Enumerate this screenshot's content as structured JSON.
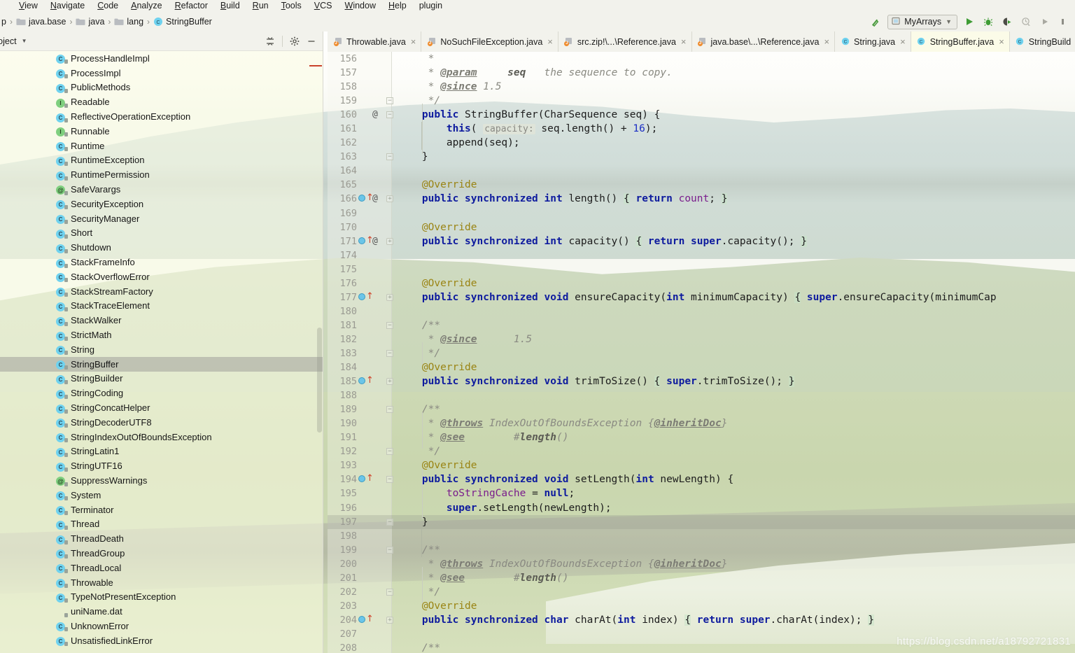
{
  "menubar": {
    "items": [
      "View",
      "Navigate",
      "Code",
      "Analyze",
      "Refactor",
      "Build",
      "Run",
      "Tools",
      "VCS",
      "Window",
      "Help",
      "plugin"
    ]
  },
  "navbar": {
    "crumbs": [
      {
        "label": "java.base",
        "icon": "folder-icon"
      },
      {
        "label": "java",
        "icon": "folder-icon"
      },
      {
        "label": "lang",
        "icon": "folder-icon"
      },
      {
        "label": "StringBuffer",
        "icon": "class-icon"
      }
    ],
    "build_icon": "hammer-build-icon",
    "run_config": {
      "label": "MyArrays",
      "icon": "run-config-icon",
      "chevron": "chevron-down-icon"
    },
    "actions": [
      "run-icon",
      "debug-icon",
      "run-with-coverage-icon",
      "profiler-icon",
      "rerun-icon",
      "stop-icon"
    ]
  },
  "sidebar": {
    "title": "roject",
    "actions": [
      "collapse-all-icon",
      "settings-gear-icon",
      "hide-panel-icon"
    ],
    "tree": [
      {
        "label": "ProcessHandleImpl",
        "kind": "class"
      },
      {
        "label": "ProcessImpl",
        "kind": "class"
      },
      {
        "label": "PublicMethods",
        "kind": "class"
      },
      {
        "label": "Readable",
        "kind": "interface"
      },
      {
        "label": "ReflectiveOperationException",
        "kind": "class"
      },
      {
        "label": "Runnable",
        "kind": "interface"
      },
      {
        "label": "Runtime",
        "kind": "class"
      },
      {
        "label": "RuntimeException",
        "kind": "class"
      },
      {
        "label": "RuntimePermission",
        "kind": "class"
      },
      {
        "label": "SafeVarargs",
        "kind": "annotation"
      },
      {
        "label": "SecurityException",
        "kind": "class"
      },
      {
        "label": "SecurityManager",
        "kind": "class"
      },
      {
        "label": "Short",
        "kind": "class"
      },
      {
        "label": "Shutdown",
        "kind": "class"
      },
      {
        "label": "StackFrameInfo",
        "kind": "class"
      },
      {
        "label": "StackOverflowError",
        "kind": "class"
      },
      {
        "label": "StackStreamFactory",
        "kind": "class"
      },
      {
        "label": "StackTraceElement",
        "kind": "class"
      },
      {
        "label": "StackWalker",
        "kind": "class"
      },
      {
        "label": "StrictMath",
        "kind": "class"
      },
      {
        "label": "String",
        "kind": "class"
      },
      {
        "label": "StringBuffer",
        "kind": "class",
        "selected": true
      },
      {
        "label": "StringBuilder",
        "kind": "class"
      },
      {
        "label": "StringCoding",
        "kind": "class"
      },
      {
        "label": "StringConcatHelper",
        "kind": "class"
      },
      {
        "label": "StringDecoderUTF8",
        "kind": "class"
      },
      {
        "label": "StringIndexOutOfBoundsException",
        "kind": "class"
      },
      {
        "label": "StringLatin1",
        "kind": "class"
      },
      {
        "label": "StringUTF16",
        "kind": "class"
      },
      {
        "label": "SuppressWarnings",
        "kind": "annotation"
      },
      {
        "label": "System",
        "kind": "class"
      },
      {
        "label": "Terminator",
        "kind": "class"
      },
      {
        "label": "Thread",
        "kind": "class"
      },
      {
        "label": "ThreadDeath",
        "kind": "class"
      },
      {
        "label": "ThreadGroup",
        "kind": "class"
      },
      {
        "label": "ThreadLocal",
        "kind": "class"
      },
      {
        "label": "Throwable",
        "kind": "class"
      },
      {
        "label": "TypeNotPresentException",
        "kind": "class"
      },
      {
        "label": "uniName.dat",
        "kind": "file"
      },
      {
        "label": "UnknownError",
        "kind": "class"
      },
      {
        "label": "UnsatisfiedLinkError",
        "kind": "class"
      }
    ]
  },
  "tabs": [
    {
      "label": "Throwable.java",
      "icon": "java-file-icon",
      "active": false
    },
    {
      "label": "NoSuchFileException.java",
      "icon": "java-file-icon",
      "active": false
    },
    {
      "label": "src.zip!\\...\\Reference.java",
      "icon": "java-file-icon",
      "active": false
    },
    {
      "label": "java.base\\...\\Reference.java",
      "icon": "java-file-icon",
      "active": false
    },
    {
      "label": "String.java",
      "icon": "class-file-icon",
      "active": false
    },
    {
      "label": "StringBuffer.java",
      "icon": "class-file-icon",
      "active": true
    },
    {
      "label": "StringBuild",
      "icon": "class-file-icon",
      "active": false
    }
  ],
  "tab_close_glyph": "×",
  "editor": {
    "file": "StringBuffer.java",
    "lines": [
      {
        "n": "156",
        "html": "<span class='cmt'>     *</span>"
      },
      {
        "n": "157",
        "html": "<span class='cmt'>     * </span><span class='tag'>@param</span><span class='cmt'>     </span><span class='cmtb'>seq</span><span class='cmt'>   the sequence to copy.</span>"
      },
      {
        "n": "158",
        "html": "<span class='cmt'>     * </span><span class='tag'>@since</span><span class='cmt'> 1.5</span>"
      },
      {
        "n": "159",
        "html": "<span class='cmt'>     */</span>",
        "fold": "minus",
        "at": false
      },
      {
        "n": "160",
        "html": "<span class='kw'>    public </span><span class='id'>StringBuffer(CharSequence seq) </span><span class='brc2'>{</span>",
        "at": true,
        "fold": "minus-stem"
      },
      {
        "n": "161",
        "html": "<span class='id'>        </span><span class='kw'>this</span><span class='id'>( </span><span class='hint'>capacity:</span><span class='id'> seq.length() + </span><span class='num'>16</span><span class='id'>);</span>"
      },
      {
        "n": "162",
        "html": "<span class='id'>        append(seq);</span>"
      },
      {
        "n": "163",
        "html": "<span class='id'>    }</span>",
        "fold": "minus-end"
      },
      {
        "n": "164",
        "html": ""
      },
      {
        "n": "165",
        "html": "<span class='anno'>    @Override</span>"
      },
      {
        "n": "166",
        "html": "<span class='kw'>    public synchronized int </span><span class='id'>length() </span><span class='brc'>{</span><span class='kw'> return </span><span class='fld'>count</span><span class='id'>; </span><span class='brc'>}</span>",
        "override": true,
        "at": true,
        "fold": "plus"
      },
      {
        "n": "169",
        "html": ""
      },
      {
        "n": "170",
        "html": "<span class='anno'>    @Override</span>"
      },
      {
        "n": "171",
        "html": "<span class='kw'>    public synchronized int </span><span class='id'>capacity() </span><span class='brc'>{</span><span class='kw'> return </span><span class='kw'>super</span><span class='id'>.capacity(); </span><span class='brc'>}</span>",
        "override": true,
        "at": true,
        "fold": "plus"
      },
      {
        "n": "174",
        "html": ""
      },
      {
        "n": "175",
        "html": ""
      },
      {
        "n": "176",
        "html": "<span class='anno'>    @Override</span>"
      },
      {
        "n": "177",
        "html": "<span class='kw'>    public synchronized void </span><span class='id'>ensureCapacity(</span><span class='kw'>int </span><span class='id'>minimumCapacity) </span><span class='brc'>{</span><span class='kw'> super</span><span class='id'>.ensureCapacity(minimumCap</span>",
        "override": true,
        "fold": "plus"
      },
      {
        "n": "180",
        "html": ""
      },
      {
        "n": "181",
        "html": "<span class='cmt'>    /**</span>",
        "fold": "minus"
      },
      {
        "n": "182",
        "html": "<span class='cmt'>     * </span><span class='tag'>@since</span><span class='cmt'>      1.5</span>"
      },
      {
        "n": "183",
        "html": "<span class='cmt'>     */</span>",
        "fold": "minus-end"
      },
      {
        "n": "184",
        "html": "<span class='anno'>    @Override</span>"
      },
      {
        "n": "185",
        "html": "<span class='kw'>    public synchronized void </span><span class='id'>trimToSize() </span><span class='brc'>{</span><span class='kw'> super</span><span class='id'>.trimToSize(); </span><span class='brc'>}</span>",
        "override": true,
        "fold": "plus"
      },
      {
        "n": "188",
        "html": ""
      },
      {
        "n": "189",
        "html": "<span class='cmt'>    /**</span>",
        "fold": "minus"
      },
      {
        "n": "190",
        "html": "<span class='cmt'>     * </span><span class='tag'>@throws</span><span class='cmt'> IndexOutOfBoundsException {</span><span class='tag'>@inheritDoc</span><span class='cmt'>}</span>"
      },
      {
        "n": "191",
        "html": "<span class='cmt'>     * </span><span class='tag'>@see</span><span class='cmt'>        #</span><span class='cmtb'>length</span><span class='cmt'>()</span>"
      },
      {
        "n": "192",
        "html": "<span class='cmt'>     */</span>",
        "fold": "minus-end"
      },
      {
        "n": "193",
        "html": "<span class='anno'>    @Override</span>"
      },
      {
        "n": "194",
        "html": "<span class='kw'>    public synchronized void </span><span class='id'>setLength(</span><span class='kw'>int </span><span class='id'>newLength) </span><span class='brc2'>{</span>",
        "override": true,
        "fold": "minus-stem"
      },
      {
        "n": "195",
        "html": "<span class='id'>        </span><span class='fld'>toStringCache</span><span class='id'> = </span><span class='kw'>null</span><span class='id'>;</span>"
      },
      {
        "n": "196",
        "html": "<span class='id'>        </span><span class='kw'>super</span><span class='id'>.setLength(newLength);</span>"
      },
      {
        "n": "197",
        "html": "<span class='id'>    }</span>",
        "caret": true,
        "fold": "minus-end"
      },
      {
        "n": "198",
        "html": ""
      },
      {
        "n": "199",
        "html": "<span class='cmt'>    /**</span>",
        "fold": "minus"
      },
      {
        "n": "200",
        "html": "<span class='cmt'>     * </span><span class='tag'>@throws</span><span class='cmt'> IndexOutOfBoundsException {</span><span class='tag'>@inheritDoc</span><span class='cmt'>}</span>"
      },
      {
        "n": "201",
        "html": "<span class='cmt'>     * </span><span class='tag'>@see</span><span class='cmt'>        #</span><span class='cmtb'>length</span><span class='cmt'>()</span>"
      },
      {
        "n": "202",
        "html": "<span class='cmt'>     */</span>",
        "fold": "minus-end"
      },
      {
        "n": "203",
        "html": "<span class='anno'>    @Override</span>"
      },
      {
        "n": "204",
        "html": "<span class='kw'>    public synchronized char </span><span class='id'>charAt(</span><span class='kw'>int </span><span class='id'>index) </span><span class='brc'>{</span><span class='kw'> return super</span><span class='id'>.charAt(index); </span><span class='brc'>}</span>",
        "override": true,
        "fold": "plus"
      },
      {
        "n": "207",
        "html": ""
      },
      {
        "n": "208",
        "html": "<span class='cmt'>    /**</span>"
      }
    ]
  },
  "watermark": "https://blog.csdn.net/a18792721831",
  "colors": {
    "tab_active_bg": "#fbfbe8",
    "selection_bg": "#a0a09b",
    "keyword": "#0e1b9e",
    "comment": "#8a8a82",
    "annotation": "#9a8413",
    "field": "#7a1c8c",
    "number": "#1b2ec4",
    "class_icon": "#6fd2ef",
    "interface_icon": "#7fcf7f",
    "run_green": "#3f9c35",
    "marker_red": "#c9422c"
  }
}
